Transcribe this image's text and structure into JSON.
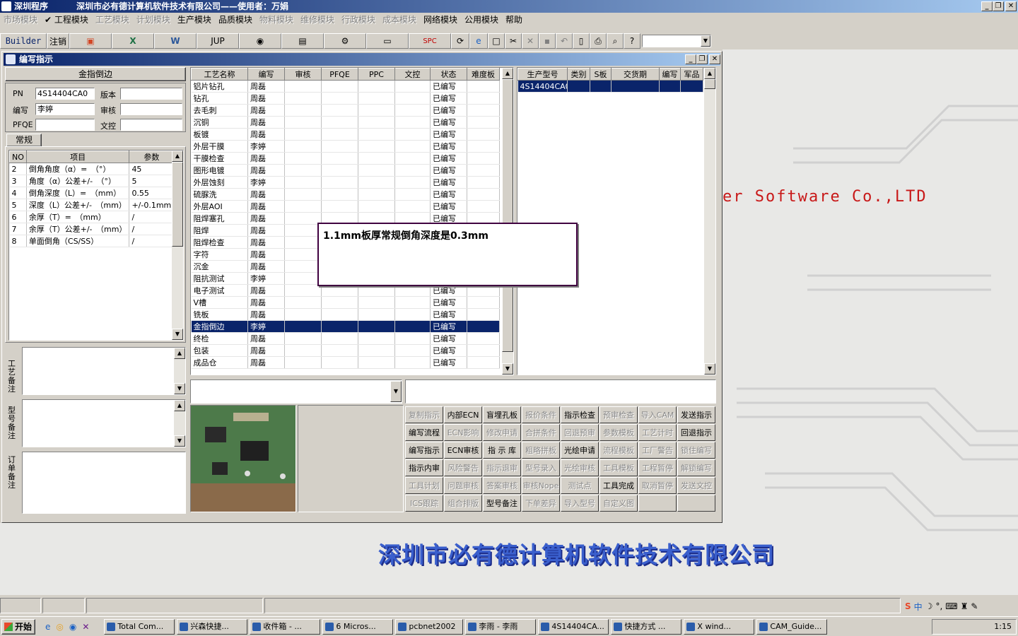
{
  "app": {
    "title": "深圳程序",
    "company": "深圳市必有德计算机软件技术有限公司——使用者：万娟"
  },
  "menu": [
    {
      "label": "市场模块",
      "enabled": false
    },
    {
      "label": "✔ 工程模块",
      "enabled": true
    },
    {
      "label": "工艺模块",
      "enabled": false
    },
    {
      "label": "计划模块",
      "enabled": false
    },
    {
      "label": "生产模块",
      "enabled": true
    },
    {
      "label": "品质模块",
      "enabled": true
    },
    {
      "label": "物料模块",
      "enabled": false
    },
    {
      "label": "维修模块",
      "enabled": false
    },
    {
      "label": "行政模块",
      "enabled": false
    },
    {
      "label": "成本模块",
      "enabled": false
    },
    {
      "label": "网络模块",
      "enabled": true
    },
    {
      "label": "公用模块",
      "enabled": true
    },
    {
      "label": "帮助",
      "enabled": true
    }
  ],
  "toolbar": {
    "builder": "Builder",
    "logout": "注销",
    "jup": "JUP",
    "spc": "SPC"
  },
  "desktop": {
    "watermark": "er Software Co.,LTD",
    "company_banner": "深圳市必有德计算机软件技术有限公司"
  },
  "window": {
    "title": "编写指示",
    "section_title": "金指倒边",
    "fields": {
      "pn_label": "PN",
      "pn_value": "4S14404CA0",
      "writer_label": "编写",
      "writer_value": "李婷",
      "pfqe_label": "PFQE",
      "pfqe_value": "",
      "version_label": "版本",
      "version_value": "",
      "review_label": "审核",
      "review_value": "",
      "doc_label": "文控",
      "doc_value": ""
    },
    "tab": "常规",
    "params_headers": [
      "NO",
      "项目",
      "参数"
    ],
    "params": [
      [
        "2",
        "倒角角度（α）=　（°）",
        "45"
      ],
      [
        "3",
        "角度（α）公差+/-　（°）",
        "5"
      ],
      [
        "4",
        "倒角深度（L）=　（mm）",
        "0.55"
      ],
      [
        "5",
        "深度（L）公差+/-　（mm）",
        "+/-0.1mm"
      ],
      [
        "6",
        "余厚（T）=　（mm）",
        "/"
      ],
      [
        "7",
        "余厚（T）公差+/-　（mm）",
        "/"
      ],
      [
        "8",
        "单面倒角（CS/SS）",
        "/"
      ]
    ],
    "notes": {
      "process": "工艺备注",
      "model": "型号备注",
      "order": "订单备注"
    },
    "process_headers": [
      "工艺名称",
      "编写",
      "审核",
      "PFQE",
      "PPC",
      "文控",
      "状态",
      "难度板"
    ],
    "process_rows": [
      [
        "铝片钻孔",
        "周磊",
        "已编写"
      ],
      [
        "钻孔",
        "周磊",
        "已编写"
      ],
      [
        "去毛刺",
        "周磊",
        "已编写"
      ],
      [
        "沉铜",
        "周磊",
        "已编写"
      ],
      [
        "板镀",
        "周磊",
        "已编写"
      ],
      [
        "外层干膜",
        "李婷",
        "已编写"
      ],
      [
        "干膜检查",
        "周磊",
        "已编写"
      ],
      [
        "图形电镀",
        "周磊",
        "已编写"
      ],
      [
        "外层蚀刻",
        "李婷",
        "已编写"
      ],
      [
        "硫脲洗",
        "周磊",
        "已编写"
      ],
      [
        "外层AOI",
        "周磊",
        "已编写"
      ],
      [
        "阻焊塞孔",
        "周磊",
        "已编写"
      ],
      [
        "阻焊",
        "周磊",
        ""
      ],
      [
        "阻焊检查",
        "周磊",
        ""
      ],
      [
        "字符",
        "周磊",
        ""
      ],
      [
        "沉金",
        "周磊",
        ""
      ],
      [
        "阻抗测试",
        "李婷",
        ""
      ],
      [
        "电子测试",
        "周磊",
        "已编写"
      ],
      [
        "V槽",
        "周磊",
        "已编写"
      ],
      [
        "铣板",
        "周磊",
        "已编写"
      ],
      [
        "金指倒边",
        "李婷",
        "已编写"
      ],
      [
        "终检",
        "周磊",
        "已编写"
      ],
      [
        "包装",
        "周磊",
        "已编写"
      ],
      [
        "成品仓",
        "周磊",
        "已编写"
      ]
    ],
    "selected_process": "金指倒边",
    "model_headers": [
      "生产型号",
      "类别",
      "S板",
      "交货期",
      "编写",
      "军品"
    ],
    "model_rows": [
      [
        "4S14404CA0",
        "",
        "",
        "",
        "",
        ""
      ]
    ],
    "popup_text": "1.1mm板厚常规倒角深度是0.3mm",
    "buttons": [
      [
        {
          "l": "复制指示",
          "e": false
        },
        {
          "l": "内部ECN",
          "e": true
        },
        {
          "l": "盲埋孔板",
          "e": true
        },
        {
          "l": "报价条件",
          "e": false
        },
        {
          "l": "指示检查",
          "e": true
        },
        {
          "l": "预审检查",
          "e": false
        },
        {
          "l": "导入CAM",
          "e": false
        },
        {
          "l": "发送指示",
          "e": true
        }
      ],
      [
        {
          "l": "编写流程",
          "e": true
        },
        {
          "l": "ECN影响",
          "e": false
        },
        {
          "l": "修改申请",
          "e": false
        },
        {
          "l": "合拼条件",
          "e": false
        },
        {
          "l": "回退预审",
          "e": false
        },
        {
          "l": "参数模板",
          "e": false
        },
        {
          "l": "工艺计时",
          "e": false
        },
        {
          "l": "回退指示",
          "e": true
        }
      ],
      [
        {
          "l": "编写指示",
          "e": true
        },
        {
          "l": "ECN审核",
          "e": true
        },
        {
          "l": "指 示 库",
          "e": true
        },
        {
          "l": "粗略拼板",
          "e": false
        },
        {
          "l": "光绘申请",
          "e": true
        },
        {
          "l": "流程模板",
          "e": false
        },
        {
          "l": "工厂警告",
          "e": false
        },
        {
          "l": "锁住编写",
          "e": false
        }
      ],
      [
        {
          "l": "指示内审",
          "e": true
        },
        {
          "l": "风险警告",
          "e": false
        },
        {
          "l": "指示退审",
          "e": false
        },
        {
          "l": "型号录入",
          "e": false
        },
        {
          "l": "光绘审核",
          "e": false
        },
        {
          "l": "工具模板",
          "e": false
        },
        {
          "l": "工程暂停",
          "e": false
        },
        {
          "l": "解锁编写",
          "e": false
        }
      ],
      [
        {
          "l": "工具计划",
          "e": false
        },
        {
          "l": "问题审核",
          "e": false
        },
        {
          "l": "答案审核",
          "e": false
        },
        {
          "l": "审核Nope",
          "e": false
        },
        {
          "l": "测试点",
          "e": false
        },
        {
          "l": "工具完成",
          "e": true
        },
        {
          "l": "取消暂停",
          "e": false
        },
        {
          "l": "发送文控",
          "e": false
        }
      ],
      [
        {
          "l": "ICS跟踪",
          "e": false
        },
        {
          "l": "组合排版",
          "e": false
        },
        {
          "l": "型号备注",
          "e": true
        },
        {
          "l": "下单差异",
          "e": false
        },
        {
          "l": "导入型号",
          "e": false
        },
        {
          "l": "自定义图",
          "e": false
        },
        {
          "l": "",
          "e": false
        },
        {
          "l": "",
          "e": false
        }
      ]
    ]
  },
  "taskbar": {
    "start": "开始",
    "tasks": [
      "Total Com...",
      "兴森快捷...",
      "收件箱 - ...",
      "6 Micros...",
      "pcbnet2002",
      "李雨 - 李雨",
      "4S14404CA...",
      "快捷方式 ...",
      "X wind...",
      "CAM_Guide..."
    ],
    "ime": "中",
    "clock": "1:15"
  }
}
